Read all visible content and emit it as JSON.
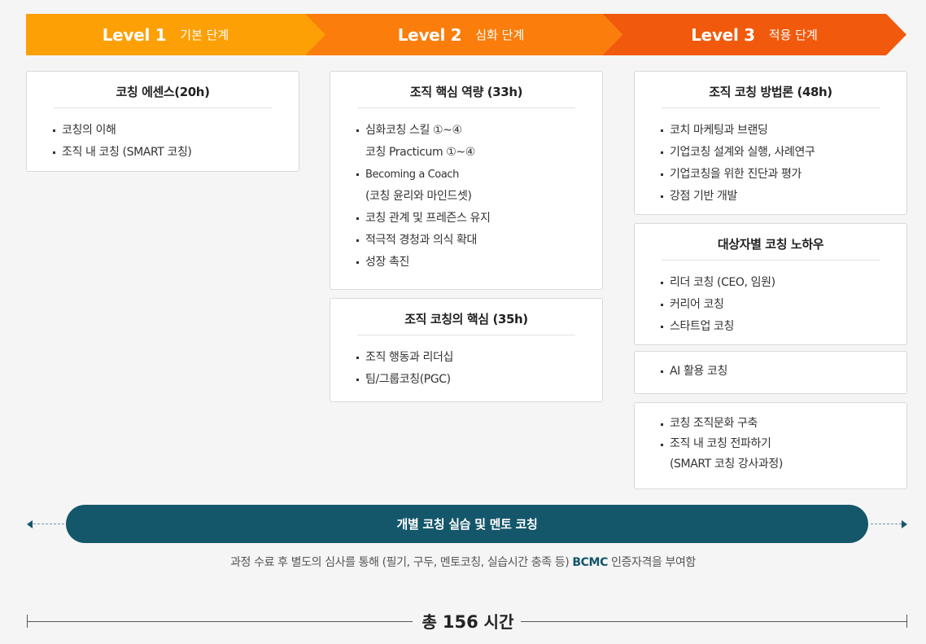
{
  "levels": [
    {
      "level": "Level 1",
      "stage": "기본 단계",
      "color": "#fda005"
    },
    {
      "level": "Level 2",
      "stage": "심화 단계",
      "color": "#fb7d0b"
    },
    {
      "level": "Level 3",
      "stage": "적용 단계",
      "color": "#f15a0c"
    }
  ],
  "level1": {
    "essence": {
      "title": "코칭 에센스(20h)",
      "items": [
        "코칭의 이해",
        "조직 내 코칭 (SMART 코칭)"
      ]
    }
  },
  "level2": {
    "core_competency": {
      "title": "조직 핵심 역량 (33h)",
      "items": [
        "심화코칭 스킬 ①~④",
        "코칭 Practicum ①~④",
        "Becoming a Coach",
        "(코칭 윤리와 마인드셋)",
        "코칭 관계 및 프레즌스 유지",
        "적극적 경청과 의식 확대",
        "성장 촉진"
      ]
    },
    "core_of_coaching": {
      "title": "조직 코칭의 핵심 (35h)",
      "items": [
        "조직 행동과 리더십",
        "팀/그룹코칭(PGC)"
      ]
    }
  },
  "level3": {
    "methodology": {
      "title": "조직 코칭 방법론 (48h)",
      "items": [
        "코치 마케팅과 브랜딩",
        "기업코칭 설계와 실행, 사례연구",
        "기업코칭을 위한 진단과 평가",
        "강점 기반 개발"
      ]
    },
    "target_knowhow": {
      "title": "대상자별 코칭 노하우",
      "items": [
        "리더 코칭 (CEO, 임원)",
        "커리어 코칭",
        "스타트업 코칭"
      ]
    },
    "ai": {
      "items": [
        "AI 활용 코칭"
      ]
    },
    "culture": {
      "items": [
        "코칭 조직문화 구축",
        "조직 내 코칭 전파하기",
        "(SMART 코칭 강사과정)"
      ]
    }
  },
  "practice": {
    "label": "개별 코칭 실습 및 멘토 코칭"
  },
  "note": {
    "before": "과정 수료 후 별도의 심사를 통해 (필기, 구두, 멘토코칭, 실습시간 충족 등) ",
    "highlight": "BCMC",
    "after": " 인증자격을 부여함"
  },
  "total": {
    "prefix": "총 ",
    "hours": "156",
    "suffix": " 시간"
  },
  "colors": {
    "accent_teal": "#14566a"
  }
}
